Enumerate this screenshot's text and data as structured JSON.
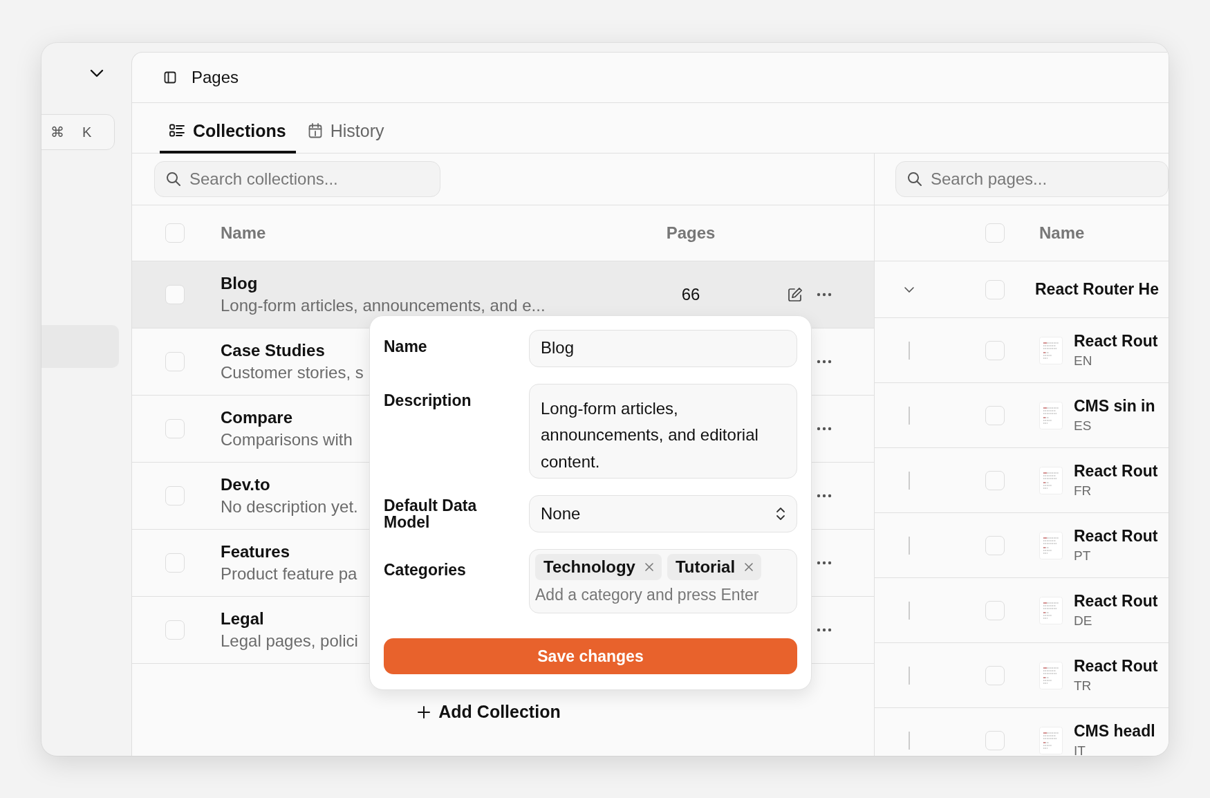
{
  "sidebar": {
    "shortcut_keys": [
      "⌘",
      "K"
    ]
  },
  "header": {
    "title": "Pages"
  },
  "tabs": [
    {
      "label": "Collections",
      "selected": true
    },
    {
      "label": "History",
      "selected": false
    }
  ],
  "collections": {
    "search": {
      "placeholder": "Search collections..."
    },
    "columns": [
      "Name",
      "Pages"
    ],
    "header_checked": false,
    "rows": [
      {
        "title": "Blog",
        "description": "Long-form articles, announcements, and e...",
        "pages": "66",
        "checked": false,
        "highlighted": true
      },
      {
        "title": "Case Studies",
        "description": "Customer stories, s",
        "checked": false,
        "highlighted": false
      },
      {
        "title": "Compare",
        "description": "Comparisons with",
        "checked": false,
        "highlighted": false
      },
      {
        "title": "Dev.to",
        "description": "No description yet.",
        "checked": false,
        "highlighted": false
      },
      {
        "title": "Features",
        "description": "Product feature pa",
        "checked": false,
        "highlighted": false
      },
      {
        "title": "Legal",
        "description": "Legal pages, polici",
        "checked": false,
        "highlighted": false
      }
    ],
    "add_button": "Add Collection"
  },
  "editor": {
    "name": {
      "label": "Name",
      "value": "Blog"
    },
    "description": {
      "label": "Description",
      "value": "Long-form articles, announcements, and editorial content."
    },
    "data_model": {
      "label": "Default Data Model",
      "value": "None"
    },
    "categories": {
      "label": "Categories",
      "tags": [
        "Technology",
        "Tutorial"
      ],
      "placeholder": "Add a category and press Enter"
    },
    "save_button": "Save changes"
  },
  "pages": {
    "search": {
      "placeholder": "Search pages..."
    },
    "columns": [
      "Name"
    ],
    "header_checked": false,
    "group": {
      "title": "React Router He",
      "expanded": true,
      "checked": false,
      "children": [
        {
          "title": "React Rout",
          "lang": "EN",
          "checked": false
        },
        {
          "title": "CMS sin in",
          "lang": "ES",
          "checked": false
        },
        {
          "title": "React Rout",
          "lang": "FR",
          "checked": false
        },
        {
          "title": "React Rout",
          "lang": "PT",
          "checked": false
        },
        {
          "title": "React Rout",
          "lang": "DE",
          "checked": false
        },
        {
          "title": "React Rout",
          "lang": "TR",
          "checked": false
        },
        {
          "title": "CMS headl",
          "lang": "IT",
          "checked": false
        }
      ]
    }
  }
}
